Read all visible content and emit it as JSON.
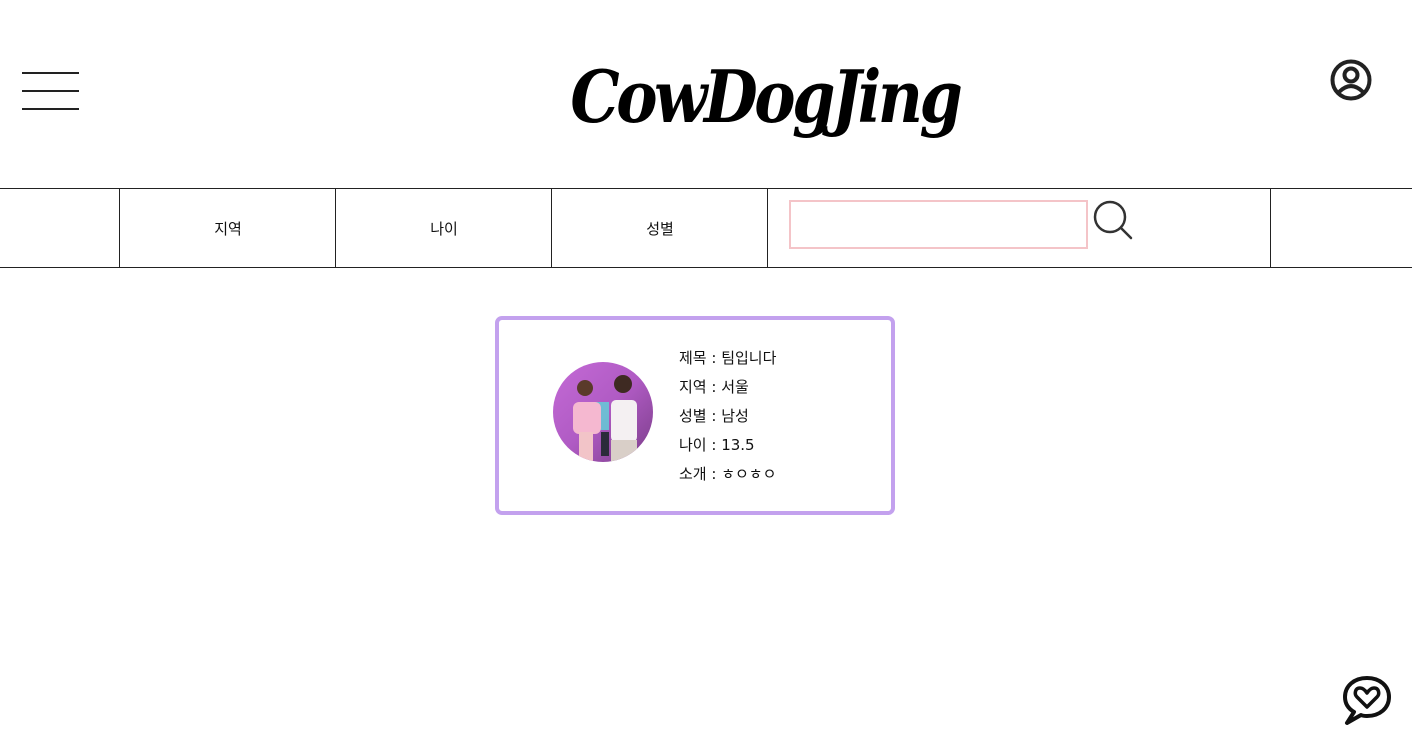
{
  "header": {
    "logo_text": "CowDogJing",
    "menu_icon": "hamburger-menu-icon",
    "profile_icon": "user-circle-icon"
  },
  "filters": {
    "items": [
      {
        "label": "지역"
      },
      {
        "label": "나이"
      },
      {
        "label": "성별"
      }
    ],
    "search": {
      "value": "",
      "placeholder": "",
      "icon": "search-icon",
      "border_color": "#f4c4c8"
    }
  },
  "card": {
    "border_color": "#c3a1ee",
    "rows": [
      {
        "label": "제목",
        "value": "팀입니다"
      },
      {
        "label": "지역",
        "value": "서울"
      },
      {
        "label": "성별",
        "value": "남성"
      },
      {
        "label": "나이",
        "value": "13.5"
      },
      {
        "label": "소개",
        "value": "ㅎㅇㅎㅇ"
      }
    ],
    "row_texts": [
      "제목 : 팀입니다",
      "지역 : 서울",
      "성별 : 남성",
      "나이 : 13.5",
      "소개 : ㅎㅇㅎㅇ"
    ]
  },
  "chat": {
    "icon": "chat-heart-icon"
  }
}
